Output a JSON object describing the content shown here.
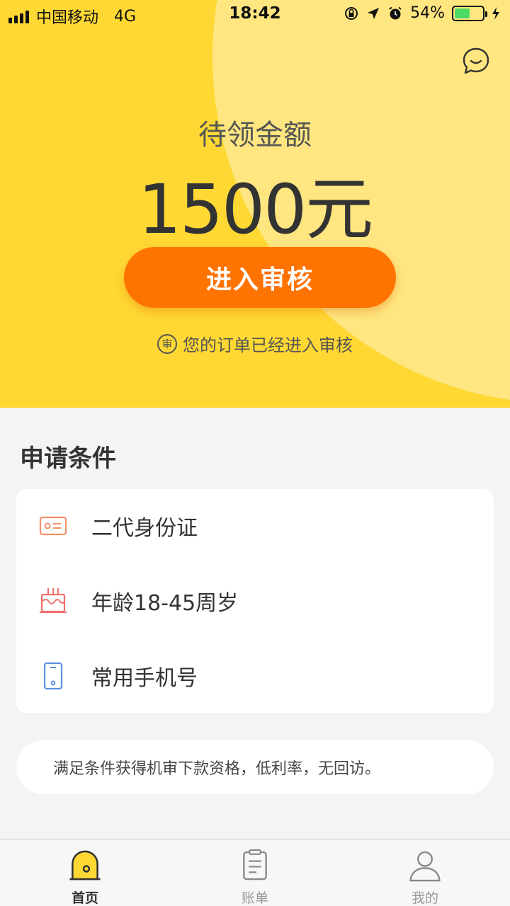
{
  "status_bar": {
    "carrier": "中国移动",
    "network": "4G",
    "time": "18:42",
    "battery": "54%",
    "battery_level": 0.54
  },
  "hero": {
    "label": "待领金额",
    "amount": "1500元",
    "button_label": "进入审核",
    "note_icon_char": "审",
    "note": "您的订单已经进入审核"
  },
  "conditions": {
    "title": "申请条件",
    "items": [
      {
        "label": "二代身份证",
        "icon": "id-card-icon"
      },
      {
        "label": "年龄18-45周岁",
        "icon": "birthday-cake-icon"
      },
      {
        "label": "常用手机号",
        "icon": "mobile-phone-icon"
      }
    ]
  },
  "tip": "满足条件获得机审下款资格，低利率，无回访。",
  "tabs": [
    {
      "label": "首页",
      "icon": "home-icon",
      "active": true
    },
    {
      "label": "账单",
      "icon": "bill-icon",
      "active": false
    },
    {
      "label": "我的",
      "icon": "profile-icon",
      "active": false
    }
  ],
  "colors": {
    "hero_bg": "#FFD833",
    "hero_circle": "#FFE680",
    "accent": "#FF7300",
    "battery": "#4CD964"
  }
}
